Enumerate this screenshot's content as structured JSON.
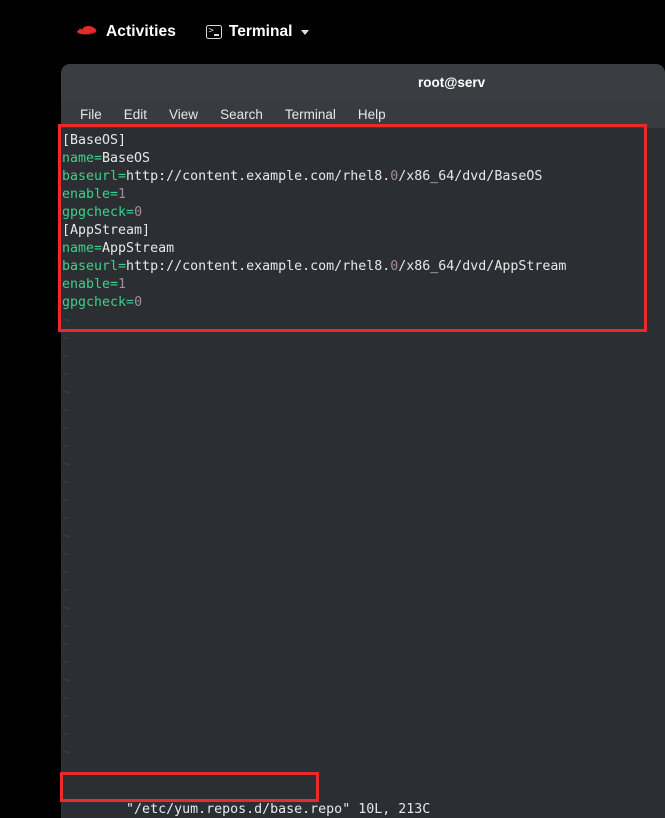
{
  "desktop": {
    "activities_label": "Activities",
    "logo_icon": "red-hat-logo-icon",
    "app_entry": {
      "icon": "terminal-icon",
      "label": "Terminal",
      "caret_icon": "chevron-down-icon"
    }
  },
  "window": {
    "title": "root@serv",
    "menubar": [
      {
        "label": "File"
      },
      {
        "label": "Edit"
      },
      {
        "label": "View"
      },
      {
        "label": "Search"
      },
      {
        "label": "Terminal"
      },
      {
        "label": "Help"
      }
    ]
  },
  "editor": {
    "application": "vim",
    "file_lines": [
      {
        "type": "section",
        "raw": "[BaseOS]",
        "section": "[BaseOS]"
      },
      {
        "type": "keyvalue",
        "raw": "name=BaseOS",
        "key": "name=",
        "value": "BaseOS"
      },
      {
        "type": "keyvalue",
        "raw": "baseurl=http://content.example.com/rhel8.0/x86_64/dvd/BaseOS",
        "key": "baseurl=",
        "value_pre": "http://content.example.com/rhel8.",
        "value_num": "0",
        "value_post": "/x86_64/dvd/BaseOS"
      },
      {
        "type": "keynum",
        "raw": "enable=1",
        "key": "enable=",
        "num": "1"
      },
      {
        "type": "keynum",
        "raw": "gpgcheck=0",
        "key": "gpgcheck=",
        "num": "0"
      },
      {
        "type": "section",
        "raw": "[AppStream]",
        "section": "[AppStream]"
      },
      {
        "type": "keyvalue",
        "raw": "name=AppStream",
        "key": "name=",
        "value": "AppStream"
      },
      {
        "type": "keyvalue",
        "raw": "baseurl=http://content.example.com/rhel8.0/x86_64/dvd/AppStream",
        "key": "baseurl=",
        "value_pre": "http://content.example.com/rhel8.",
        "value_num": "0",
        "value_post": "/x86_64/dvd/AppStream"
      },
      {
        "type": "keynum",
        "raw": "enable=1",
        "key": "enable=",
        "num": "1"
      },
      {
        "type": "keynum",
        "raw": "gpgcheck=0",
        "key": "gpgcheck=",
        "num": "0"
      }
    ],
    "empty_marker": "~",
    "empty_marker_count": 25,
    "status": {
      "filename": "\"/etc/yum.repos.d/base.repo\"",
      "metrics": " 10L, 213C"
    }
  },
  "annotations": [
    {
      "name": "config-block-highlight",
      "color": "#ec2b28"
    },
    {
      "name": "filename-highlight",
      "color": "#ec2b28"
    }
  ],
  "colors": {
    "annotation_red": "#ec2b28",
    "terminal_bg": "#2b2e33",
    "titlebar_bg": "#3a3e43",
    "menubar_bg": "#383c41",
    "desktop_bg": "#000000",
    "key_green": "#3fd08a",
    "number_mauve": "#a88a9c",
    "text_white": "#e8e8e8",
    "tilde_blue": "#34414f"
  }
}
